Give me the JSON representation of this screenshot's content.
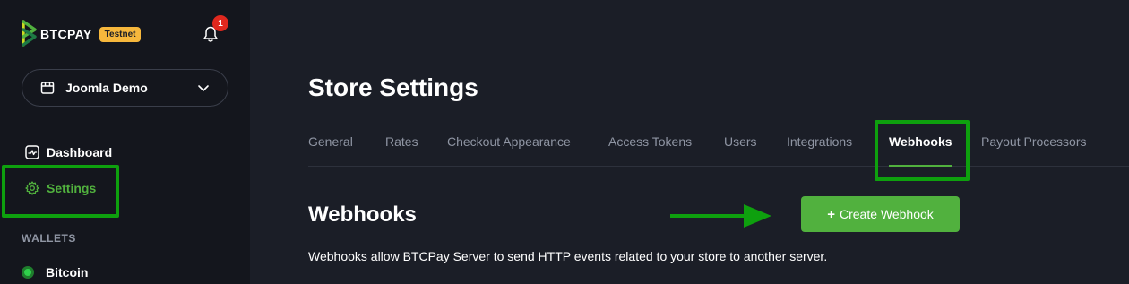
{
  "brand": {
    "name": "BTCPAY",
    "env_badge": "Testnet",
    "colors": {
      "accent": "#51b13e",
      "badge": "#f6b73c",
      "highlight": "#0ea00e"
    }
  },
  "notifications": {
    "count": "1",
    "icon": "bell-icon"
  },
  "store_selector": {
    "name": "Joomla Demo",
    "icon": "store-icon"
  },
  "sidebar": {
    "items": [
      {
        "label": "Dashboard",
        "icon": "dashboard-icon"
      },
      {
        "label": "Settings",
        "icon": "gear-icon",
        "active": true
      }
    ],
    "wallets_heading": "WALLETS",
    "wallets": [
      {
        "label": "Bitcoin",
        "status": "green-dot"
      }
    ]
  },
  "main": {
    "title": "Store Settings",
    "tabs": [
      {
        "label": "General"
      },
      {
        "label": "Rates"
      },
      {
        "label": "Checkout Appearance"
      },
      {
        "label": "Access Tokens"
      },
      {
        "label": "Users"
      },
      {
        "label": "Integrations"
      },
      {
        "label": "Webhooks",
        "active": true
      },
      {
        "label": "Payout Processors"
      }
    ],
    "section_title": "Webhooks",
    "create_button": {
      "plus": "+",
      "label": "Create Webhook"
    },
    "description": "Webhooks allow BTCPay Server to send HTTP events related to your store to another server."
  }
}
